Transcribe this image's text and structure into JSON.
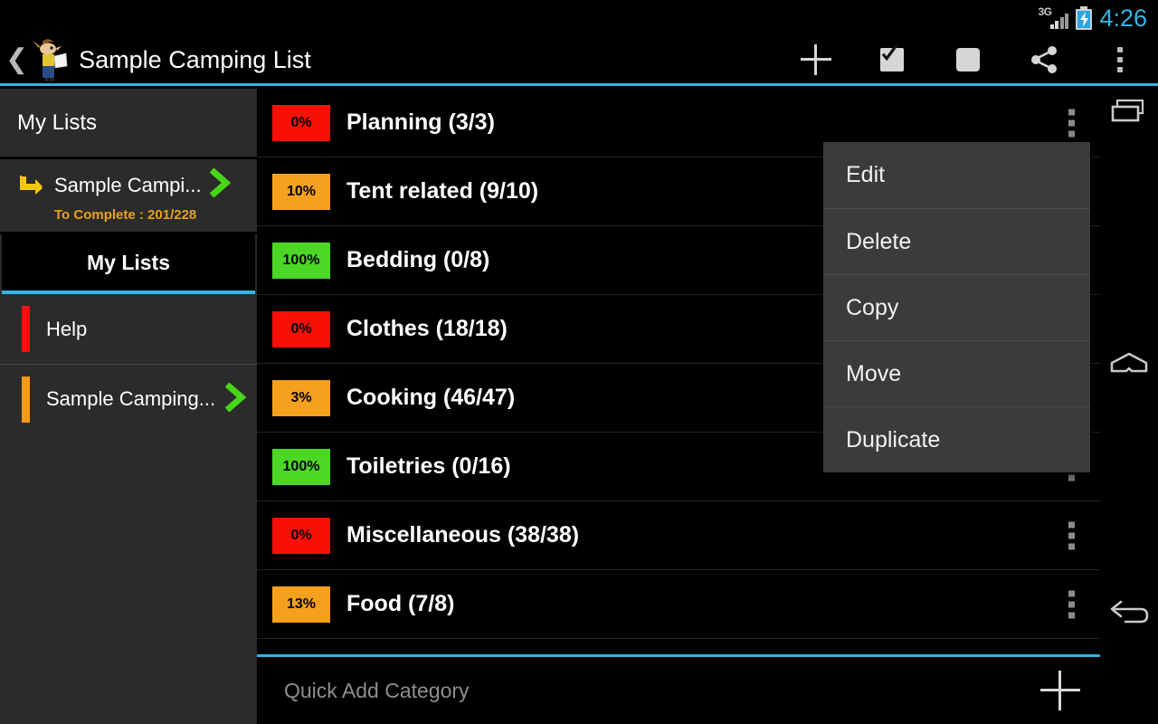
{
  "status_bar": {
    "network": "3G",
    "battery_icon": "battery-charging-icon",
    "time": "4:26",
    "time_color": "#33b5e5"
  },
  "action_bar": {
    "back_icon": "back-chevron-icon",
    "app_icon": "app-logo-icon",
    "title": "Sample Camping List",
    "actions": [
      {
        "name": "add-button",
        "icon": "plus-icon"
      },
      {
        "name": "select-all-button",
        "icon": "checkbox-checked-icon"
      },
      {
        "name": "deselect-button",
        "icon": "square-icon"
      },
      {
        "name": "share-button",
        "icon": "share-icon"
      },
      {
        "name": "overflow-button",
        "icon": "kebab-menu-icon"
      }
    ]
  },
  "sidebar": {
    "header_title": "My Lists",
    "breadcrumb": {
      "arrow_icon": "corner-arrow-icon",
      "label": "Sample Campi...",
      "chevron_icon": "chevron-right-icon",
      "progress_text": "To Complete : 201/228",
      "progress_color": "#e8a317"
    },
    "tab_label": "My Lists",
    "items": [
      {
        "label": "Help",
        "color": "#f80f0f",
        "chevron": false
      },
      {
        "label": "Sample Camping...",
        "color": "#f59b16",
        "chevron": true
      }
    ]
  },
  "main": {
    "rows": [
      {
        "percent": "0%",
        "color": "#fa0f06",
        "label": "Planning (3/3)",
        "menu_icon": "kebab-menu-icon"
      },
      {
        "percent": "10%",
        "color": "#f5a11e",
        "label": "Tent related (9/10)",
        "menu_icon": "kebab-menu-icon"
      },
      {
        "percent": "100%",
        "color": "#4cd726",
        "label": "Bedding (0/8)",
        "menu_icon": "kebab-menu-icon"
      },
      {
        "percent": "0%",
        "color": "#fa0f06",
        "label": "Clothes (18/18)",
        "menu_icon": "kebab-menu-icon"
      },
      {
        "percent": "3%",
        "color": "#f5a11e",
        "label": "Cooking (46/47)",
        "menu_icon": "kebab-menu-icon"
      },
      {
        "percent": "100%",
        "color": "#4cd726",
        "label": "Toiletries (0/16)",
        "menu_icon": "kebab-menu-icon"
      },
      {
        "percent": "0%",
        "color": "#fa0f06",
        "label": "Miscellaneous (38/38)",
        "menu_icon": "kebab-menu-icon"
      },
      {
        "percent": "13%",
        "color": "#f5a11e",
        "label": "Food (7/8)",
        "menu_icon": "kebab-menu-icon"
      }
    ],
    "quick_add": {
      "placeholder": "Quick Add Category",
      "button_icon": "plus-icon"
    }
  },
  "context_menu": {
    "items": [
      "Edit",
      "Delete",
      "Copy",
      "Move",
      "Duplicate"
    ]
  },
  "nav_bar": {
    "recent_icon": "recents-icon",
    "home_icon": "home-icon",
    "back_icon": "back-arrow-icon"
  }
}
